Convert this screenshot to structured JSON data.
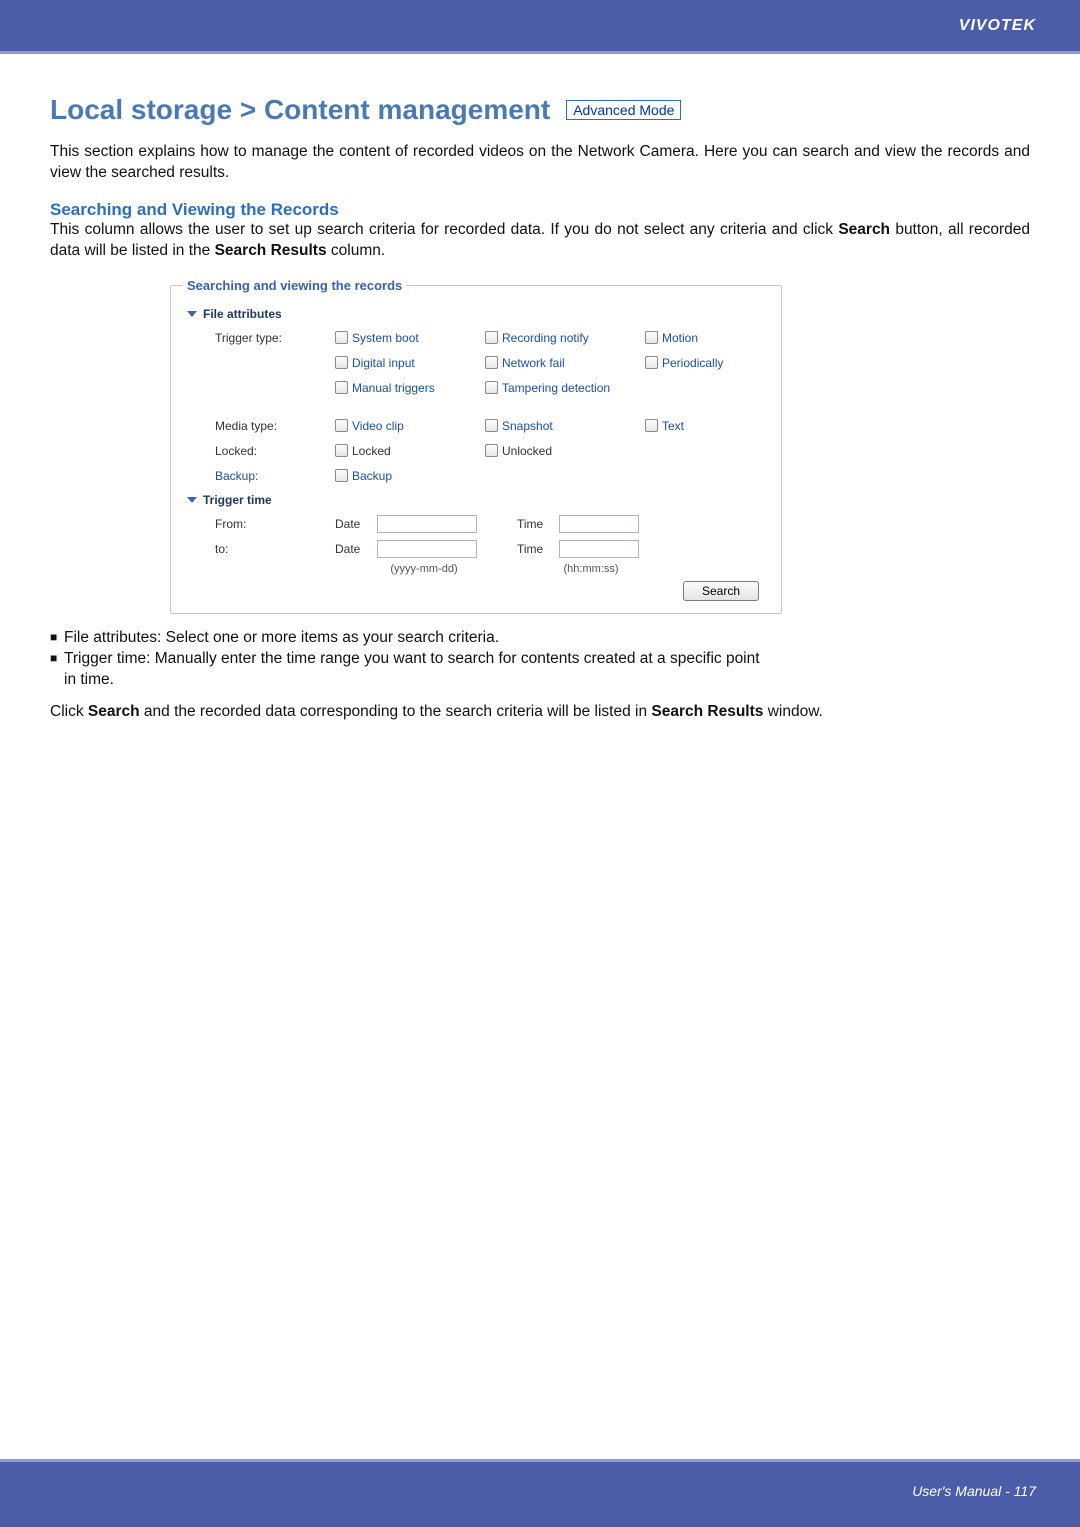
{
  "header": {
    "brand": "VIVOTEK"
  },
  "title": {
    "heading": "Local storage > Content management",
    "badge": "Advanced Mode"
  },
  "intro": "This section explains how to manage the content of recorded videos on the Network Camera. Here you can search and view the records and view the searched results.",
  "section1": {
    "heading": "Searching and Viewing the Records",
    "lead_pre": "This column allows the user to set up search criteria for recorded data. If you do not select any criteria and click ",
    "lead_b1": "Search",
    "lead_mid": " button, all recorded data will be listed in the ",
    "lead_b2": "Search Results",
    "lead_post": " column."
  },
  "panel": {
    "legend": "Searching and viewing the records",
    "file_attr_head": "File attributes",
    "trigger_type_label": "Trigger type:",
    "trigger_opts": {
      "system_boot": "System boot",
      "recording_notify": "Recording notify",
      "motion": "Motion",
      "digital_input": "Digital input",
      "network_fail": "Network fail",
      "periodically": "Periodically",
      "manual_triggers": "Manual triggers",
      "tampering_detection": "Tampering detection"
    },
    "media_type_label": "Media type:",
    "media_opts": {
      "video_clip": "Video clip",
      "snapshot": "Snapshot",
      "text": "Text"
    },
    "locked_label": "Locked:",
    "locked_opts": {
      "locked": "Locked",
      "unlocked": "Unlocked"
    },
    "backup_label": "Backup:",
    "backup_opts": {
      "backup": "Backup"
    },
    "trigger_time_head": "Trigger time",
    "from_label": "From:",
    "to_label": "to:",
    "date_label": "Date",
    "time_label": "Time",
    "date_hint": "(yyyy-mm-dd)",
    "time_hint": "(hh:mm:ss)",
    "search_btn": "Search"
  },
  "bullets": {
    "b1": "File attributes: Select one or more items as your search criteria.",
    "b2a": "Trigger time: Manually enter the time range you want to search for contents created at a specific point",
    "b2b": "in time."
  },
  "closing": {
    "pre": "Click ",
    "b1": "Search",
    "mid": " and the recorded data corresponding to the search criteria will be listed in ",
    "b2": "Search Results",
    "post": " window."
  },
  "footer": {
    "text": "User's Manual - 117"
  }
}
